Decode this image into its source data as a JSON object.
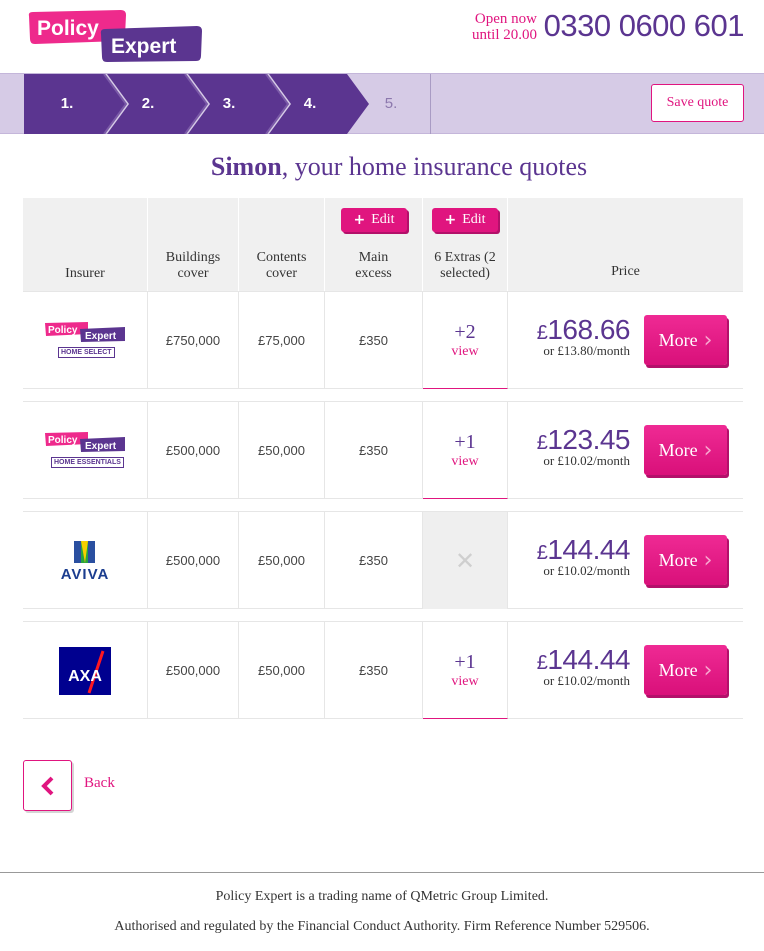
{
  "brand": {
    "logo_word1": "Policy",
    "logo_word2": "Expert",
    "colors": {
      "primary": "#5b3590",
      "accent": "#e0157f",
      "step_bg": "#d6cbe6"
    }
  },
  "header": {
    "open_line1": "Open now",
    "open_line2": "until 20.00",
    "phone": "0330 0600 601"
  },
  "steps": {
    "items": [
      {
        "label": "1.",
        "active": true
      },
      {
        "label": "2.",
        "active": true
      },
      {
        "label": "3.",
        "active": true
      },
      {
        "label": "4.",
        "active": true
      },
      {
        "label": "5.",
        "active": false
      }
    ],
    "save_label": "Save quote"
  },
  "title": {
    "name": "Simon",
    "rest": ", your home insurance quotes"
  },
  "table": {
    "headers": {
      "insurer": "Insurer",
      "buildings": "Buildings cover",
      "contents": "Contents cover",
      "excess": "Main excess",
      "extras": "6 Extras (2 selected)",
      "price": "Price",
      "edit_label": "Edit"
    },
    "rows": [
      {
        "insurer_logo": "policy-expert-home-select",
        "logo_sub": "HOME SELECT",
        "buildings": "£750,000",
        "contents": "£75,000",
        "excess": "£350",
        "extras_count": "+2",
        "extras_view": "view",
        "currency": "£",
        "price": "168.66",
        "monthly": "or £13.80/month",
        "more_label": "More"
      },
      {
        "insurer_logo": "policy-expert-home-essentials",
        "logo_sub": "HOME ESSENTIALS",
        "buildings": "£500,000",
        "contents": "£50,000",
        "excess": "£350",
        "extras_count": "+1",
        "extras_view": "view",
        "currency": "£",
        "price": "123.45",
        "monthly": "or £10.02/month",
        "more_label": "More"
      },
      {
        "insurer_logo": "aviva",
        "logo_text": "AVIVA",
        "buildings": "£500,000",
        "contents": "£50,000",
        "excess": "£350",
        "extras_count": null,
        "extras_view": null,
        "currency": "£",
        "price": "144.44",
        "monthly": "or £10.02/month",
        "more_label": "More"
      },
      {
        "insurer_logo": "axa",
        "logo_text": "AXA",
        "buildings": "£500,000",
        "contents": "£50,000",
        "excess": "£350",
        "extras_count": "+1",
        "extras_view": "view",
        "currency": "£",
        "price": "144.44",
        "monthly": "or £10.02/month",
        "more_label": "More"
      }
    ]
  },
  "back_label": "Back",
  "footer": {
    "line1": "Policy Expert is a trading name of QMetric Group Limited.",
    "line2": "Authorised and regulated by the Financial Conduct Authority. Firm Reference Number 529506."
  }
}
